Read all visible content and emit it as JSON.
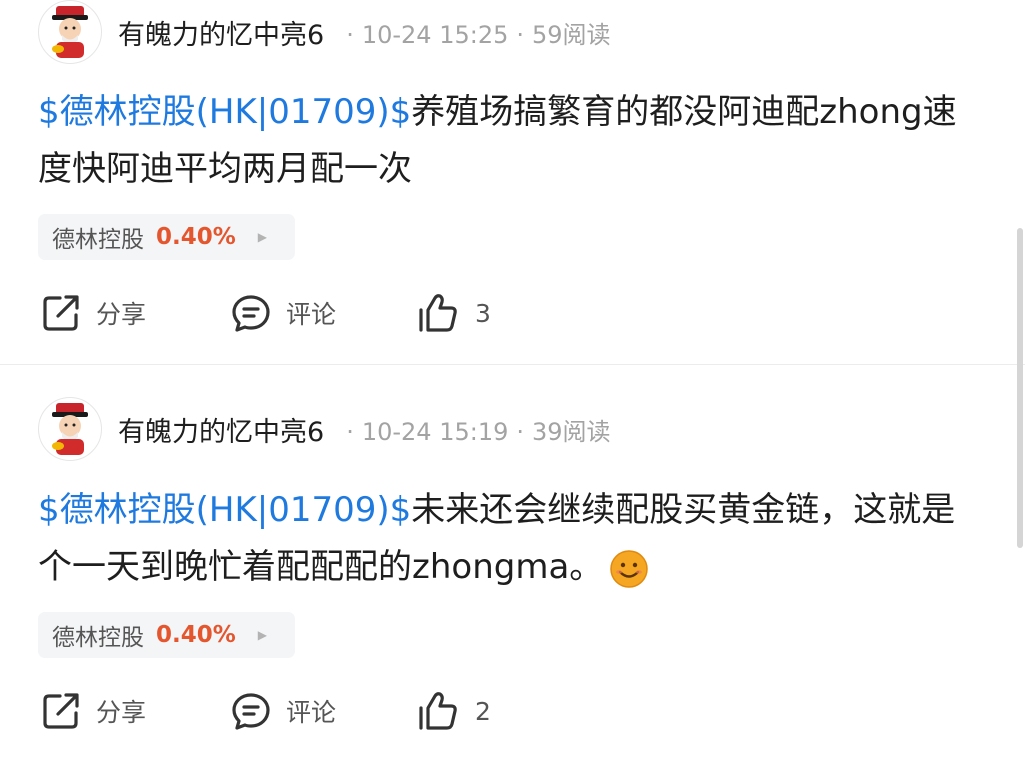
{
  "posts": [
    {
      "author": "有魄力的忆中亮6",
      "time": "10-24 15:25",
      "reads": "59阅读",
      "content_link": "$德林控股(HK|01709)$",
      "content_text": "养殖场搞繁育的都没阿迪配zhong速度快阿迪平均两月配一次",
      "stock_name": "德林控股",
      "stock_change": "0.40%",
      "share_label": "分享",
      "comment_label": "评论",
      "likes": "3"
    },
    {
      "author": "有魄力的忆中亮6",
      "time": "10-24 15:19",
      "reads": "39阅读",
      "content_link": "$德林控股(HK|01709)$",
      "content_text": "未来还会继续配股买黄金链，这就是个一天到晚忙着配配配的zhongma。",
      "emoji": "smile-emoji",
      "stock_name": "德林控股",
      "stock_change": "0.40%",
      "share_label": "分享",
      "comment_label": "评论",
      "likes": "2"
    }
  ],
  "colors": {
    "link": "#1f7ae0",
    "rise": "#e4572e",
    "meta": "#a3a3a3"
  }
}
